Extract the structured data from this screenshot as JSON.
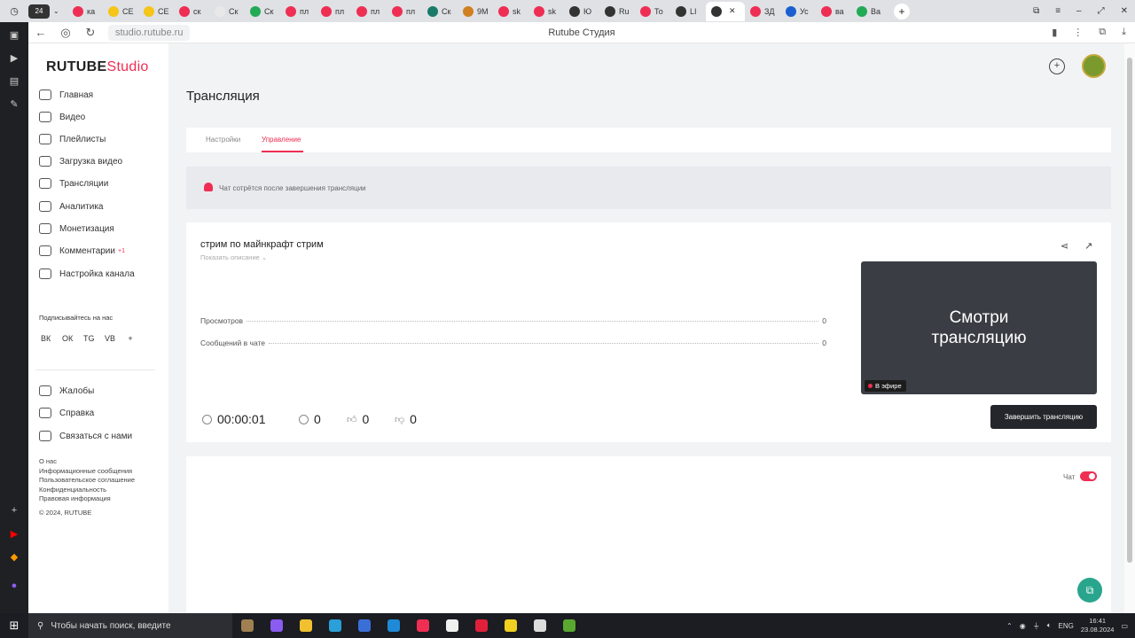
{
  "browser": {
    "url": "studio.rutube.ru",
    "page_title": "Rutube Студия",
    "tabs": [
      {
        "label": "ка",
        "color": "#ef2e53"
      },
      {
        "label": "СЕ",
        "color": "#f5c518"
      },
      {
        "label": "СЕ",
        "color": "#f5c518"
      },
      {
        "label": "ск",
        "color": "#ef2e53"
      },
      {
        "label": "Ск",
        "color": "#e8e8e8"
      },
      {
        "label": "Ск",
        "color": "#22aa55"
      },
      {
        "label": "пл",
        "color": "#ef2e53"
      },
      {
        "label": "пл",
        "color": "#ef2e53"
      },
      {
        "label": "пл",
        "color": "#ef2e53"
      },
      {
        "label": "пл",
        "color": "#ef2e53"
      },
      {
        "label": "Ск",
        "color": "#1a7a6a"
      },
      {
        "label": "9М",
        "color": "#d08020"
      },
      {
        "label": "sk",
        "color": "#ef2e53"
      },
      {
        "label": "sk",
        "color": "#ef2e53"
      },
      {
        "label": "Ю",
        "color": "#333333"
      },
      {
        "label": "Ru",
        "color": "#333333"
      },
      {
        "label": "То",
        "color": "#ef2e53"
      },
      {
        "label": "LI",
        "color": "#333333"
      },
      {
        "label": "",
        "color": "#333333",
        "active": true
      },
      {
        "label": "ЗД",
        "color": "#ef2e53"
      },
      {
        "label": "Ус",
        "color": "#1a5fd0"
      },
      {
        "label": "ва",
        "color": "#ef2e53"
      },
      {
        "label": "Ва",
        "color": "#22aa55"
      }
    ]
  },
  "sidebar": {
    "logo_main": "RUTUBE",
    "logo_studio": "Studio",
    "nav": [
      {
        "label": "Главная",
        "icon": "home-icon"
      },
      {
        "label": "Видео",
        "icon": "video-icon"
      },
      {
        "label": "Плейлисты",
        "icon": "playlist-icon"
      },
      {
        "label": "Загрузка видео",
        "icon": "upload-icon"
      },
      {
        "label": "Трансляции",
        "icon": "broadcast-icon"
      },
      {
        "label": "Аналитика",
        "icon": "analytics-icon"
      },
      {
        "label": "Монетизация",
        "icon": "money-icon"
      },
      {
        "label": "Комментарии",
        "icon": "comment-icon",
        "badge": "+1"
      },
      {
        "label": "Настройка канала",
        "icon": "wand-icon"
      }
    ],
    "subscribe_label": "Подписывайтесь на нас",
    "socials": [
      "ВК",
      "ОК",
      "TG",
      "VB",
      "+"
    ],
    "support": [
      {
        "label": "Жалобы",
        "icon": "flag-icon"
      },
      {
        "label": "Справка",
        "icon": "question-icon"
      },
      {
        "label": "Связаться с нами",
        "icon": "contact-icon"
      }
    ],
    "footer_links": [
      "О нас",
      "Информационные сообщения",
      "Пользовательское соглашение",
      "Конфиденциальность",
      "Правовая информация"
    ],
    "copyright": "© 2024, RUTUBE"
  },
  "main": {
    "title": "Трансляция",
    "tabs": [
      {
        "label": "Настройки",
        "active": false
      },
      {
        "label": "Управление",
        "active": true
      }
    ],
    "notice": "Чат сотрётся после завершения трансляции",
    "stream": {
      "name": "стрим по майнкрафт стрим",
      "show_description": "Показать описание",
      "stats": [
        {
          "label": "Просмотров",
          "value": "0"
        },
        {
          "label": "Сообщений в чате",
          "value": "0"
        }
      ],
      "duration": "00:00:01",
      "viewers": "0",
      "likes": "0",
      "dislikes": "0",
      "preview_text_line1": "Смотри",
      "preview_text_line2": "трансляцию",
      "live_badge": "В эфире",
      "end_button": "Завершить трансляцию"
    },
    "chat": {
      "label": "Чат",
      "enabled": true
    }
  },
  "taskbar": {
    "search_placeholder": "Чтобы начать поиск, введите",
    "lang": "ENG",
    "time": "16:41",
    "date": "23.08.2024",
    "apps": [
      {
        "name": "widget-icon",
        "color": "#a08050"
      },
      {
        "name": "copilot-icon",
        "color": "#8a5cf0"
      },
      {
        "name": "files-icon",
        "color": "#f0c030"
      },
      {
        "name": "edge-icon",
        "color": "#2a9fd8"
      },
      {
        "name": "store-icon",
        "color": "#3a6fd8"
      },
      {
        "name": "mail-icon",
        "color": "#1e8ad8"
      },
      {
        "name": "yandex-icon",
        "color": "#ef2e53"
      },
      {
        "name": "yandex-browser-icon",
        "color": "#f0f0f0"
      },
      {
        "name": "opera-icon",
        "color": "#e0203a"
      },
      {
        "name": "app-icon",
        "color": "#f0d020"
      },
      {
        "name": "obs-icon",
        "color": "#dddddd"
      },
      {
        "name": "minecraft-icon",
        "color": "#5aa830"
      }
    ]
  }
}
